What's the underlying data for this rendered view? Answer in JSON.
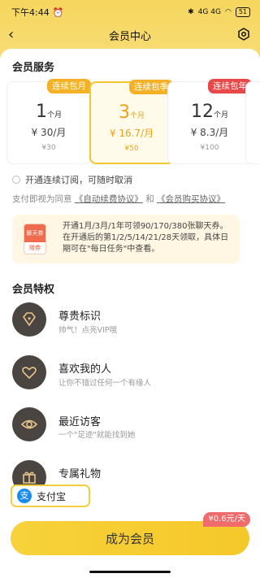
{
  "status": {
    "time": "下午4:44",
    "network": "4G 4G",
    "battery": "51"
  },
  "nav": {
    "title": "会员中心"
  },
  "services": {
    "title": "会员服务",
    "plans": [
      {
        "tag": "连续包月",
        "num": "1",
        "unit": "个月",
        "price": "¥ 30/月",
        "total": "¥30",
        "selected": false
      },
      {
        "tag": "连续包季",
        "num": "3",
        "unit": "个月",
        "price": "¥ 16.7/月",
        "total": "¥50",
        "selected": true
      },
      {
        "tag": "连续包年",
        "num": "12",
        "unit": "个月",
        "price": "¥ 8.3/月",
        "total": "¥100",
        "selected": false
      }
    ],
    "auto_renew_label": "开通连续订阅，可随时取消",
    "agree_prefix": "支付即视为同意",
    "agree_link1": "《自动续费协议》",
    "agree_and": "和",
    "agree_link2": "《会员购买协议》"
  },
  "coupon": {
    "icon_top": "聊天券",
    "icon_bottom": "赠券",
    "text": "开通1月/3月/1年可领90/170/380张聊天券。在开通后的第1/2/5/14/21/28天领取，具体日期可在\"每日任务\"中查看。"
  },
  "privileges": {
    "title": "会员特权",
    "items": [
      {
        "title": "尊贵标识",
        "sub": "帅气！点亮VIP哦",
        "icon": "diamond-heart-icon"
      },
      {
        "title": "喜欢我的人",
        "sub": "让你不错过任何一个有缘人",
        "icon": "heart-icon"
      },
      {
        "title": "最近访客",
        "sub": "一个\"足迹\"就能找到她",
        "icon": "eye-icon"
      },
      {
        "title": "专属礼物",
        "sub": "",
        "icon": "gift-icon"
      }
    ]
  },
  "payment": {
    "method": "支付宝",
    "icon": "alipay-icon"
  },
  "cta": {
    "label": "成为会员",
    "badge": "¥0.6元/天"
  },
  "colors": {
    "accent": "#f7d23a",
    "badge": "#f06b6b",
    "dark_icon_bg": "#4a4541"
  }
}
